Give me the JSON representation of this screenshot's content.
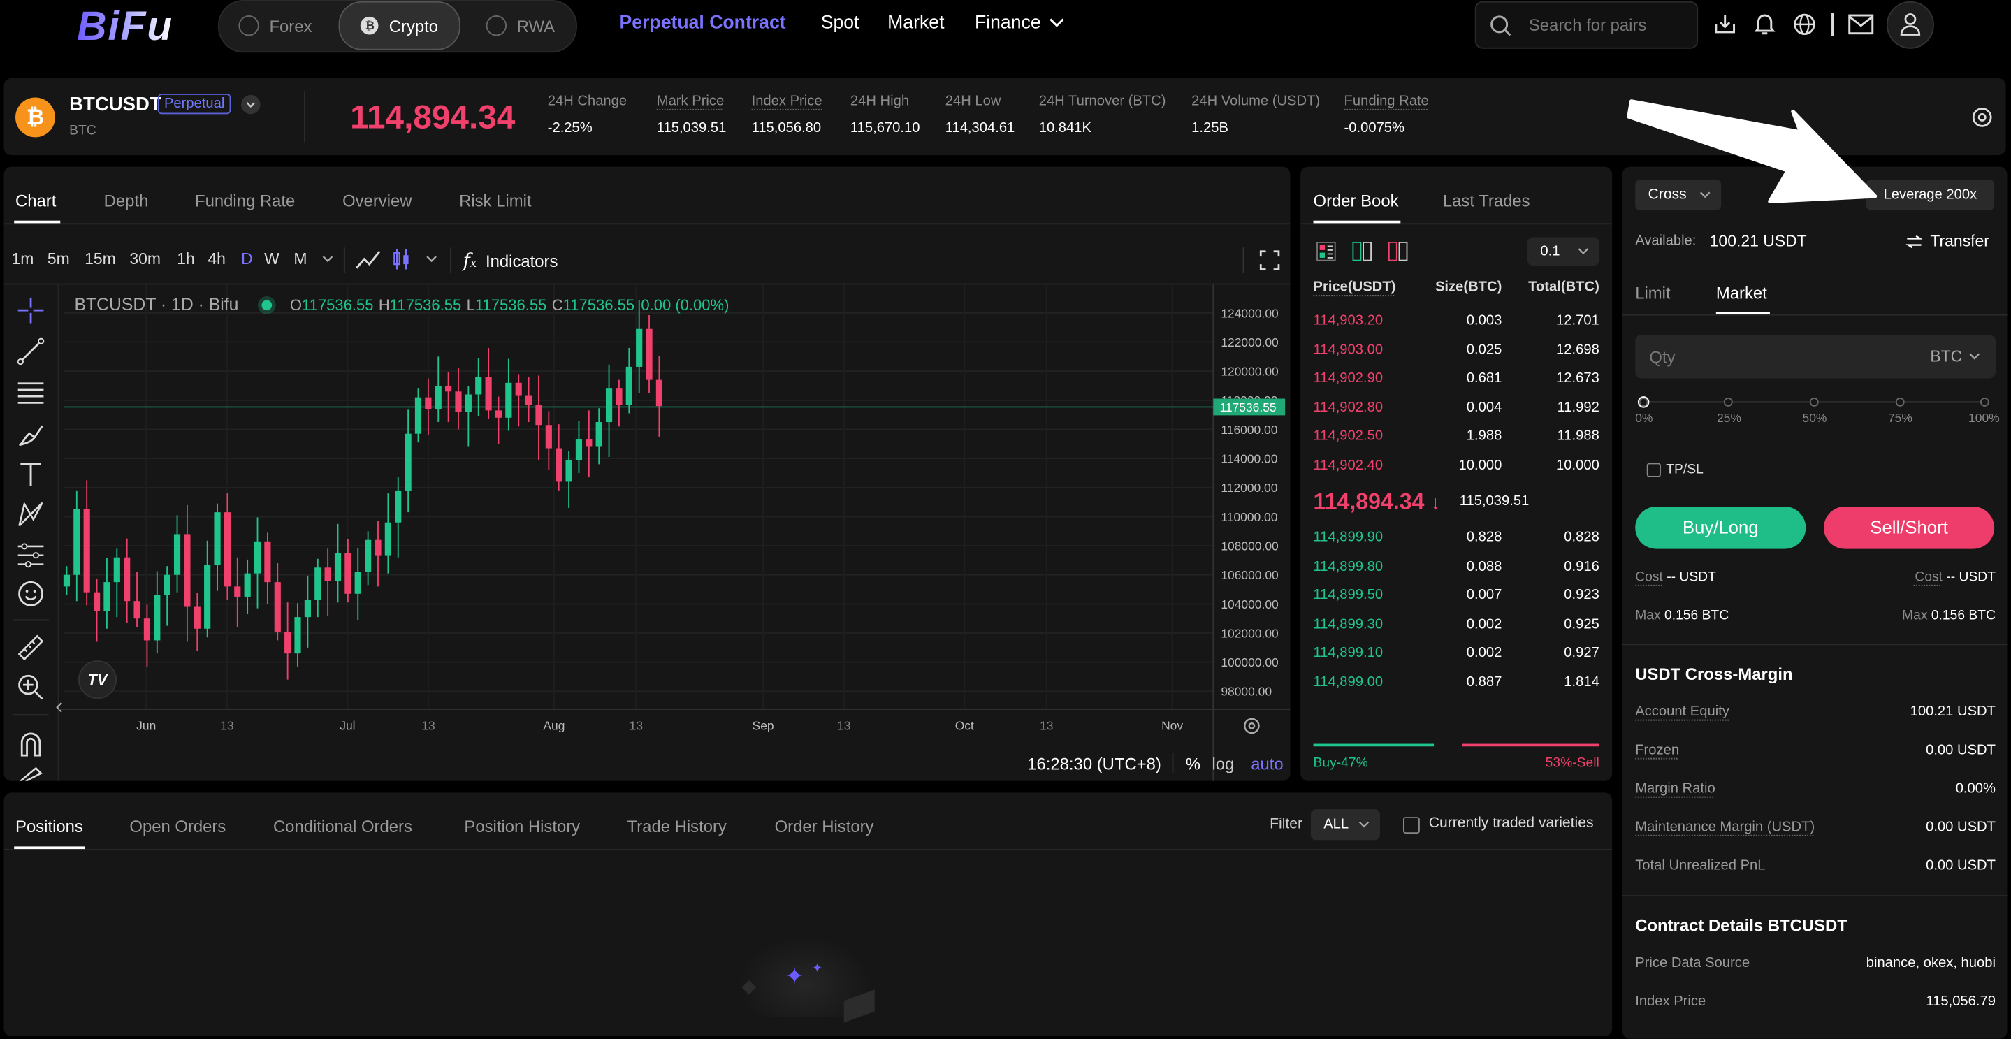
{
  "nav": {
    "logo": "BiFu",
    "asset_tabs": [
      {
        "label": "Forex"
      },
      {
        "label": "Crypto"
      },
      {
        "label": "RWA"
      }
    ],
    "menu": [
      "Perpetual Contract",
      "Spot",
      "Market",
      "Finance"
    ],
    "search_placeholder": "Search for pairs"
  },
  "ticker": {
    "symbol": "BTCUSDT",
    "badge": "Perpetual",
    "base": "BTC",
    "price": "114,894.34",
    "stats": [
      {
        "label": "24H Change",
        "value": "-2.25%"
      },
      {
        "label": "Mark Price",
        "value": "115,039.51"
      },
      {
        "label": "Index Price",
        "value": "115,056.80"
      },
      {
        "label": "24H High",
        "value": "115,670.10"
      },
      {
        "label": "24H Low",
        "value": "114,304.61"
      },
      {
        "label": "24H Turnover (BTC)",
        "value": "10.841K"
      },
      {
        "label": "24H Volume (USDT)",
        "value": "1.25B"
      },
      {
        "label": "Funding Rate",
        "value": "-0.0075%"
      }
    ]
  },
  "chart_tabs": [
    "Chart",
    "Depth",
    "Funding Rate",
    "Overview",
    "Risk Limit"
  ],
  "intervals": [
    "1m",
    "5m",
    "15m",
    "30m",
    "1h",
    "4h",
    "D",
    "W",
    "M"
  ],
  "indicators_label": "Indicators",
  "chart_legend": {
    "title": "BTCUSDT · 1D · Bifu",
    "o_label": "O",
    "o": "117536.55",
    "h_label": "H",
    "h": "117536.55",
    "l_label": "L",
    "l": "117536.55",
    "c_label": "C",
    "c": "117536.55",
    "change": "0.00 (0.00%)"
  },
  "chart_footer": {
    "time": "16:28:30 (UTC+8)",
    "pct": "%",
    "log": "log",
    "auto": "auto"
  },
  "chart_data": {
    "type": "candlestick",
    "y_ticks": [
      "124000.00",
      "122000.00",
      "120000.00",
      "118000.00",
      "116000.00",
      "114000.00",
      "112000.00",
      "110000.00",
      "108000.00",
      "106000.00",
      "104000.00",
      "102000.00",
      "100000.00",
      "98000.00"
    ],
    "x_ticks": [
      "Jun",
      "13",
      "Jul",
      "13",
      "Aug",
      "13",
      "Sep",
      "13",
      "Oct",
      "13",
      "Nov"
    ],
    "last_price_label": "117536.55",
    "ylim": [
      97000,
      125000
    ],
    "approx_path": [
      106000,
      110500,
      104800,
      103500,
      105500,
      107200,
      104200,
      103000,
      101500,
      104600,
      106000,
      108800,
      103800,
      102300,
      106700,
      110300,
      105200,
      104500,
      106100,
      108300,
      105500,
      102100,
      100600,
      103100,
      104300,
      106500,
      105600,
      107500,
      104700,
      106200,
      108400,
      107300,
      109600,
      111800,
      115700,
      118200,
      117400,
      119000,
      118600,
      117200,
      118400,
      119600,
      117300,
      116800,
      119200,
      118300,
      117700,
      116300,
      114700,
      112400,
      113900,
      115300,
      114800,
      116500,
      118800,
      117700,
      120300,
      122900,
      119400,
      117600
    ],
    "grid": true
  },
  "orderbook": {
    "tabs": [
      "Order Book",
      "Last Trades"
    ],
    "precision": "0.1",
    "headers": [
      "Price(USDT)",
      "Size(BTC)",
      "Total(BTC)"
    ],
    "asks": [
      [
        "114,903.20",
        "0.003",
        "12.701"
      ],
      [
        "114,903.00",
        "0.025",
        "12.698"
      ],
      [
        "114,902.90",
        "0.681",
        "12.673"
      ],
      [
        "114,902.80",
        "0.004",
        "11.992"
      ],
      [
        "114,902.50",
        "1.988",
        "11.988"
      ],
      [
        "114,902.40",
        "10.000",
        "10.000"
      ]
    ],
    "last_price": "114,894.34",
    "arrow": "↓",
    "mark": "115,039.51",
    "bids": [
      [
        "114,899.90",
        "0.828",
        "0.828"
      ],
      [
        "114,899.80",
        "0.088",
        "0.916"
      ],
      [
        "114,899.50",
        "0.007",
        "0.923"
      ],
      [
        "114,899.30",
        "0.002",
        "0.925"
      ],
      [
        "114,899.10",
        "0.002",
        "0.927"
      ],
      [
        "114,899.00",
        "0.887",
        "1.814"
      ]
    ],
    "buy_pct": "Buy-47%",
    "sell_pct": "53%-Sell"
  },
  "bottom": {
    "tabs": [
      "Positions",
      "Open Orders",
      "Conditional Orders",
      "Position History",
      "Trade History",
      "Order History"
    ],
    "filter_label": "Filter",
    "filter_value": "ALL",
    "checkbox_label": "Currently traded varieties"
  },
  "trade": {
    "margin_mode": "Cross",
    "leverage": "Leverage 200x",
    "available_label": "Available:",
    "available_value": "100.21 USDT",
    "transfer": "Transfer",
    "order_tabs": [
      "Limit",
      "Market"
    ],
    "qty_placeholder": "Qty",
    "qty_unit": "BTC",
    "slider_marks": [
      "0%",
      "25%",
      "50%",
      "75%",
      "100%"
    ],
    "tpsl": "TP/SL",
    "buy": "Buy/Long",
    "sell": "Sell/Short",
    "cost_label": "Cost",
    "cost_value": "-- USDT",
    "max_label": "Max",
    "max_value": "0.156 BTC",
    "account_title": "USDT Cross-Margin",
    "account_rows": [
      {
        "k": "Account Equity",
        "v": "100.21 USDT"
      },
      {
        "k": "Frozen",
        "v": "0.00 USDT"
      },
      {
        "k": "Margin Ratio",
        "v": "0.00%"
      },
      {
        "k": "Maintenance Margin (USDT)",
        "v": "0.00 USDT"
      },
      {
        "k": "Total Unrealized PnL",
        "v": "0.00 USDT"
      }
    ],
    "contract_title": "Contract Details BTCUSDT",
    "contract_rows": [
      {
        "k": "Price Data Source",
        "v": "binance, okex, huobi"
      },
      {
        "k": "Index Price",
        "v": "115,056.79"
      }
    ]
  },
  "colors": {
    "accent": "#7b73ff",
    "up": "#20c58c",
    "down": "#f0406c",
    "panel": "#161616"
  }
}
